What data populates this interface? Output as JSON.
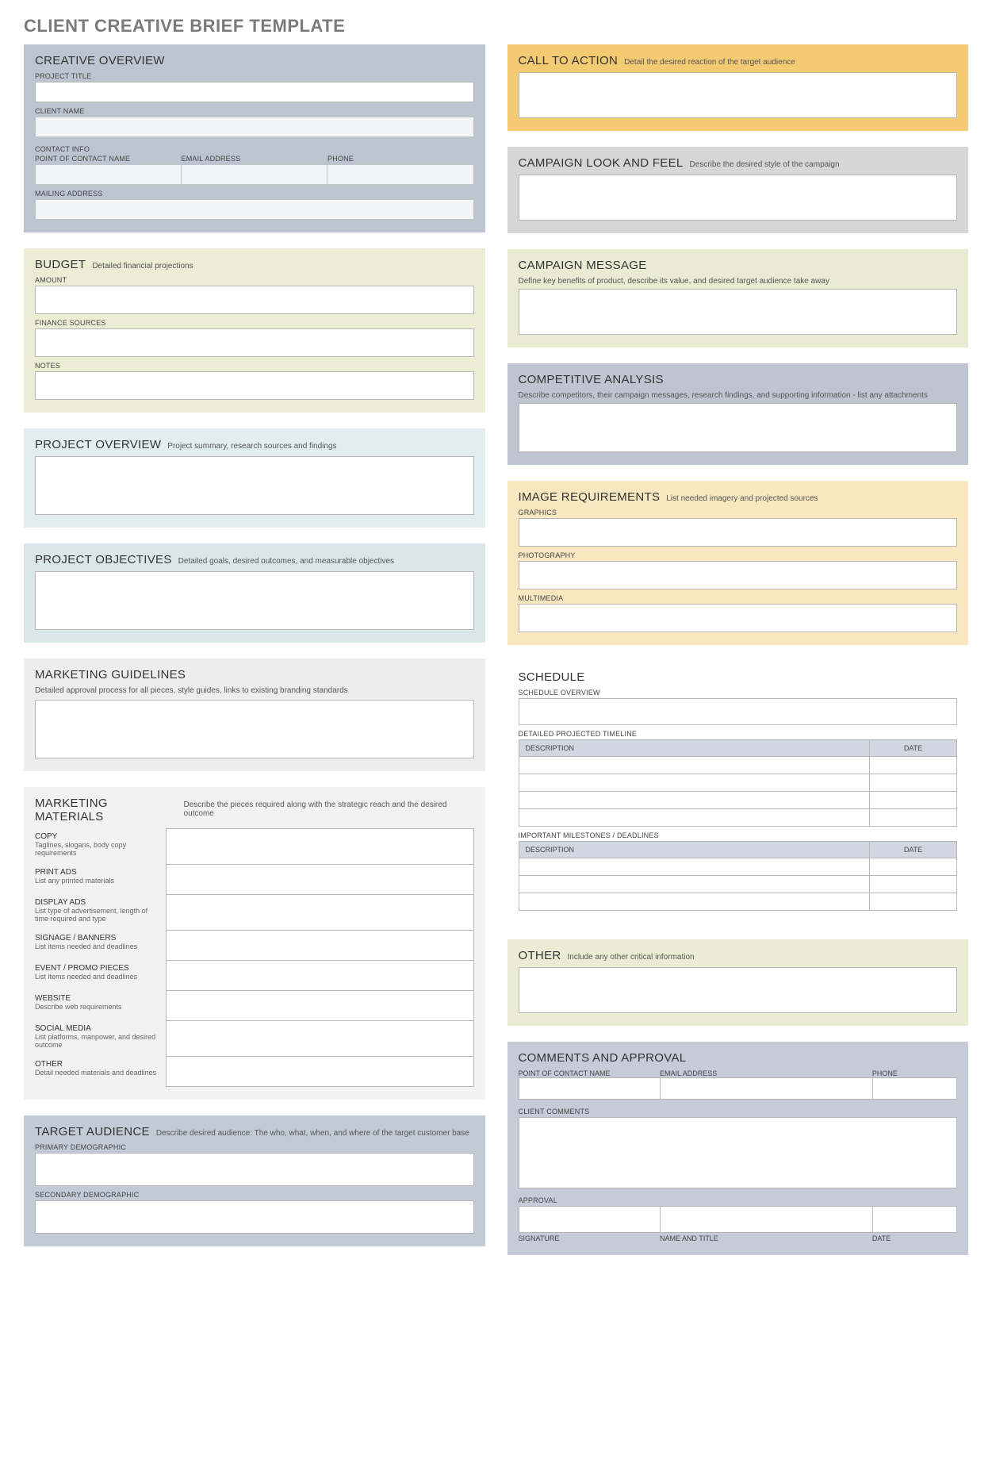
{
  "page_title": "CLIENT CREATIVE BRIEF TEMPLATE",
  "left": {
    "creative_overview": {
      "title": "CREATIVE OVERVIEW",
      "project_title_label": "PROJECT TITLE",
      "client_name_label": "CLIENT NAME",
      "contact_info_label": "CONTACT INFO",
      "poc_label": "POINT OF CONTACT NAME",
      "email_label": "EMAIL ADDRESS",
      "phone_label": "PHONE",
      "mailing_label": "MAILING ADDRESS"
    },
    "budget": {
      "title": "BUDGET",
      "sub": "Detailed financial projections",
      "amount_label": "AMOUNT",
      "finance_label": "FINANCE SOURCES",
      "notes_label": "NOTES"
    },
    "project_overview": {
      "title": "PROJECT OVERVIEW",
      "sub": "Project summary, research sources and findings"
    },
    "project_objectives": {
      "title": "PROJECT OBJECTIVES",
      "sub": "Detailed goals, desired outcomes, and measurable objectives"
    },
    "marketing_guidelines": {
      "title": "MARKETING GUIDELINES",
      "sub": "Detailed approval process for all pieces, style guides, links to existing branding standards"
    },
    "marketing_materials": {
      "title": "MARKETING MATERIALS",
      "sub": "Describe the pieces required along with the strategic reach and the desired outcome",
      "rows": [
        {
          "name": "COPY",
          "desc": "Taglines, slogans, body copy requirements"
        },
        {
          "name": "PRINT ADS",
          "desc": "List any printed materials"
        },
        {
          "name": "DISPLAY ADS",
          "desc": "List type of advertisement, length of time required and type"
        },
        {
          "name": "SIGNAGE / BANNERS",
          "desc": "List items needed and deadlines"
        },
        {
          "name": "EVENT / PROMO PIECES",
          "desc": "List items needed and deadlines"
        },
        {
          "name": "WEBSITE",
          "desc": "Describe web requirements"
        },
        {
          "name": "SOCIAL MEDIA",
          "desc": "List platforms, manpower, and desired outcome"
        },
        {
          "name": "OTHER",
          "desc": "Detail needed materials and deadlines"
        }
      ]
    },
    "target_audience": {
      "title": "TARGET AUDIENCE",
      "sub": "Describe desired audience: The who, what, when, and where of the target customer base",
      "primary_label": "PRIMARY DEMOGRAPHIC",
      "secondary_label": "SECONDARY DEMOGRAPHIC"
    }
  },
  "right": {
    "cta": {
      "title": "CALL TO ACTION",
      "sub": "Detail the desired reaction of the target audience"
    },
    "look_feel": {
      "title": "CAMPAIGN LOOK AND FEEL",
      "sub": "Describe the desired style of the campaign"
    },
    "message": {
      "title": "CAMPAIGN MESSAGE",
      "sub": "Define key benefits of product, describe its value, and desired target audience take away"
    },
    "competitive": {
      "title": "COMPETITIVE ANALYSIS",
      "sub": "Describe competitors, their campaign messages, research findings, and supporting information - list any attachments"
    },
    "image_req": {
      "title": "IMAGE REQUIREMENTS",
      "sub": "List needed imagery and projected sources",
      "graphics_label": "GRAPHICS",
      "photo_label": "PHOTOGRAPHY",
      "multi_label": "MULTIMEDIA"
    },
    "schedule": {
      "title": "SCHEDULE",
      "overview_label": "SCHEDULE OVERVIEW",
      "timeline_label": "DETAILED PROJECTED TIMELINE",
      "desc_col": "DESCRIPTION",
      "date_col": "DATE",
      "milestones_label": "IMPORTANT MILESTONES / DEADLINES"
    },
    "other": {
      "title": "OTHER",
      "sub": "Include any other critical information"
    },
    "comments": {
      "title": "COMMENTS AND APPROVAL",
      "poc_label": "POINT OF CONTACT NAME",
      "email_label": "EMAIL ADDRESS",
      "phone_label": "PHONE",
      "client_comments_label": "CLIENT COMMENTS",
      "approval_label": "APPROVAL",
      "sig_label": "SIGNATURE",
      "name_label": "NAME AND TITLE",
      "date_label": "DATE"
    }
  }
}
